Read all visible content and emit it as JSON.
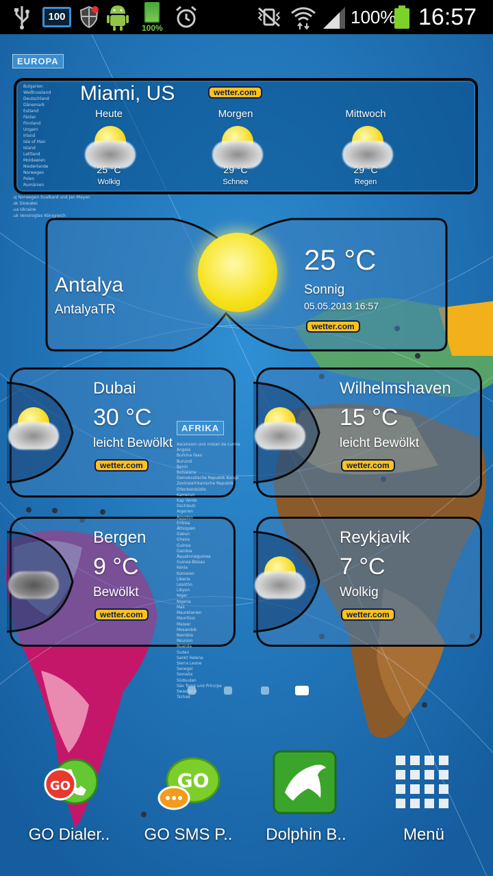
{
  "status_bar": {
    "battery_small_label": "100%",
    "badge_number": "100",
    "battery_percent": "100%",
    "time": "16:57"
  },
  "wallpaper": {
    "europa_label": "EUROPA",
    "afrika_label": "AFRIKA",
    "europe_list": [
      "Bulgarien",
      "Weißrussland",
      "Deutschland",
      "Dänemark",
      "Estland",
      "Färöer",
      "Finnland",
      "Ungarn",
      "Irland",
      "Isle of Man",
      "Island",
      "Lettland",
      "Moldawien",
      "Niederlande",
      "Norwegen",
      "Polen",
      "Rumänien"
    ],
    "europe_codes": [
      {
        "code": ".sj",
        "name": "Norwegen Svalbard und Jan Mayen"
      },
      {
        "code": ".sk",
        "name": "Slowakei"
      },
      {
        "code": ".ua",
        "name": "Ukraine"
      },
      {
        "code": ".uk",
        "name": "Vereinigtes Königreich"
      }
    ],
    "africa_list": [
      "Ascension und Tristan da Cunha",
      "Angola",
      "Burkina Faso",
      "Burundi",
      "Benin",
      "Botswana",
      "Demokratische Republik Kongo",
      "",
      "Zentralafrikanische Republik",
      "Elfenbeinküste",
      "Kamerun",
      "Kap Verde",
      "Dschibuti",
      "Algerien",
      "Ägypten",
      "Eritrea",
      "Äthiopien",
      "Gabun",
      "Ghana",
      "Guinea",
      "Gambia",
      "Äquatorialguinea",
      "Guinea-Bissau",
      "Kenia",
      "Komoren",
      "Liberia",
      "Lesotho",
      "Libyen",
      "Niger",
      "Nigeria",
      "",
      "Mali",
      "Mauretanien",
      "Mauritius",
      "Malawi",
      "Mosambik",
      "Namibia",
      "Réunion",
      "Ruanda",
      "Sudan",
      "Sankt Helena",
      "Sierra Leone",
      "Senegal",
      "Somalia",
      "Südsudan",
      "São Tomé und Príncipe",
      "Swasiland",
      "Tschad"
    ]
  },
  "miami_widget": {
    "city": "Miami, US",
    "brand": "wetter.com",
    "days": [
      {
        "day": "Heute",
        "temp": "25 °C",
        "condition": "Wolkig"
      },
      {
        "day": "Morgen",
        "temp": "29 °C",
        "condition": "Schnee"
      },
      {
        "day": "Mittwoch",
        "temp": "29 °C",
        "condition": "Regen"
      }
    ]
  },
  "antalya_widget": {
    "city": "Antalya",
    "subtitle": "AntalyaTR",
    "temp": "25 °C",
    "condition": "Sonnig",
    "datetime": "05.05.2013 16:57",
    "brand": "wetter.com"
  },
  "small_widgets": [
    {
      "city": "Dubai",
      "temp": "30 °C",
      "condition": "leicht Bewölkt",
      "brand": "wetter.com"
    },
    {
      "city": "Wilhelmshaven",
      "temp": "15 °C",
      "condition": "leicht Bewölkt",
      "brand": "wetter.com"
    },
    {
      "city": "Bergen",
      "temp": "9 °C",
      "condition": "Bewölkt",
      "brand": "wetter.com"
    },
    {
      "city": "Reykjavik",
      "temp": "7 °C",
      "condition": "Wolkig",
      "brand": "wetter.com"
    }
  ],
  "page_indicator": {
    "pages": 4,
    "active": 4
  },
  "dock": [
    {
      "label": "GO Dialer..",
      "icon": "go-dialer-icon"
    },
    {
      "label": "GO SMS P..",
      "icon": "go-sms-icon"
    },
    {
      "label": "Dolphin B..",
      "icon": "dolphin-browser-icon"
    },
    {
      "label": "Menü",
      "icon": "app-drawer-icon"
    }
  ]
}
